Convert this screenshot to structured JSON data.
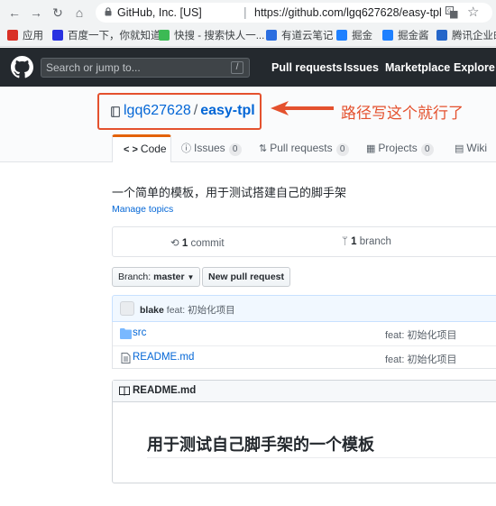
{
  "browser": {
    "site_name": "GitHub, Inc. [US]",
    "separator": "|",
    "url": "https://github.com/lgq627628/easy-tpl"
  },
  "bookmarks": [
    {
      "label": "应用",
      "icon_color": "#d93025",
      "icon": "apps-grid-icon"
    },
    {
      "label": "百度一下，你就知道",
      "icon_color": "#2932e1",
      "icon": "baidu-paw-icon"
    },
    {
      "label": "快搜 - 搜索快人一...",
      "icon_color": "#3cba54",
      "icon": "kuaisou-icon"
    },
    {
      "label": "有道云笔记",
      "icon_color": "#2b6ee0",
      "icon": "youdao-note-icon"
    },
    {
      "label": "掘金",
      "icon_color": "#1e80ff",
      "icon": "juejin-icon"
    },
    {
      "label": "掘金酱",
      "icon_color": "#1e80ff",
      "icon": "juejin-sauce-icon"
    },
    {
      "label": "腾讯企业邮",
      "icon_color": "#2667c9",
      "icon": "tencent-mail-icon"
    }
  ],
  "github": {
    "search_placeholder": "Search or jump to...",
    "slash_hint": "/",
    "nav": [
      "Pull requests",
      "Issues",
      "Marketplace",
      "Explore"
    ]
  },
  "repo": {
    "owner": "lgq627628",
    "slash": "/",
    "name": "easy-tpl",
    "annotation": "路径写这个就行了",
    "tabs": [
      {
        "label": "Code",
        "icon": "< >"
      },
      {
        "label": "Issues",
        "count": "0",
        "icon": "ⓘ"
      },
      {
        "label": "Pull requests",
        "count": "0",
        "icon": "⇅"
      },
      {
        "label": "Projects",
        "count": "0",
        "icon": "▦"
      },
      {
        "label": "Wiki",
        "icon": "▤"
      }
    ],
    "description": "一个简单的模板，用于测试搭建自己的脚手架",
    "manage_topics": "Manage topics",
    "summary": {
      "commits_count": "1",
      "commits_label": "commit",
      "branches_count": "1",
      "branches_label": "branch"
    },
    "branch_button": {
      "prefix": "Branch:",
      "value": "master"
    },
    "new_pr_button": "New pull request",
    "latest_commit": {
      "author": "blake",
      "message": "feat: 初始化项目"
    },
    "files": [
      {
        "name": "src",
        "type": "folder",
        "message": "feat: 初始化项目"
      },
      {
        "name": "README.md",
        "type": "file",
        "message": "feat: 初始化项目"
      }
    ],
    "readme": {
      "title": "README.md",
      "heading": "用于测试自己脚手架的一个模板"
    }
  },
  "colors": {
    "annotation": "#e4512e",
    "link": "#0366d6",
    "header": "#24292e",
    "active_tab": "#e36209"
  }
}
